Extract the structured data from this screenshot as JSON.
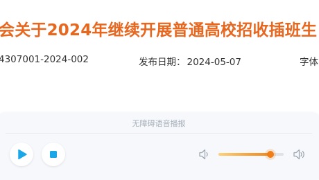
{
  "article": {
    "title": "会关于2024年继续开展普通高校招收插班生",
    "doc_number": "4307001-2024-002",
    "publish_label": "发布日期：",
    "publish_date": "2024-05-07",
    "font_label": "字体"
  },
  "player": {
    "title": "无障碍语音播报",
    "volume_level": 0.8,
    "icons": {
      "play": "play-icon",
      "stop": "stop-icon",
      "volume_low": "volume-low-icon",
      "volume_high": "volume-high-icon"
    }
  },
  "colors": {
    "title": "#e8671f",
    "accent_blue": "#1aa7e8",
    "slider_accent": "#f07d16"
  }
}
